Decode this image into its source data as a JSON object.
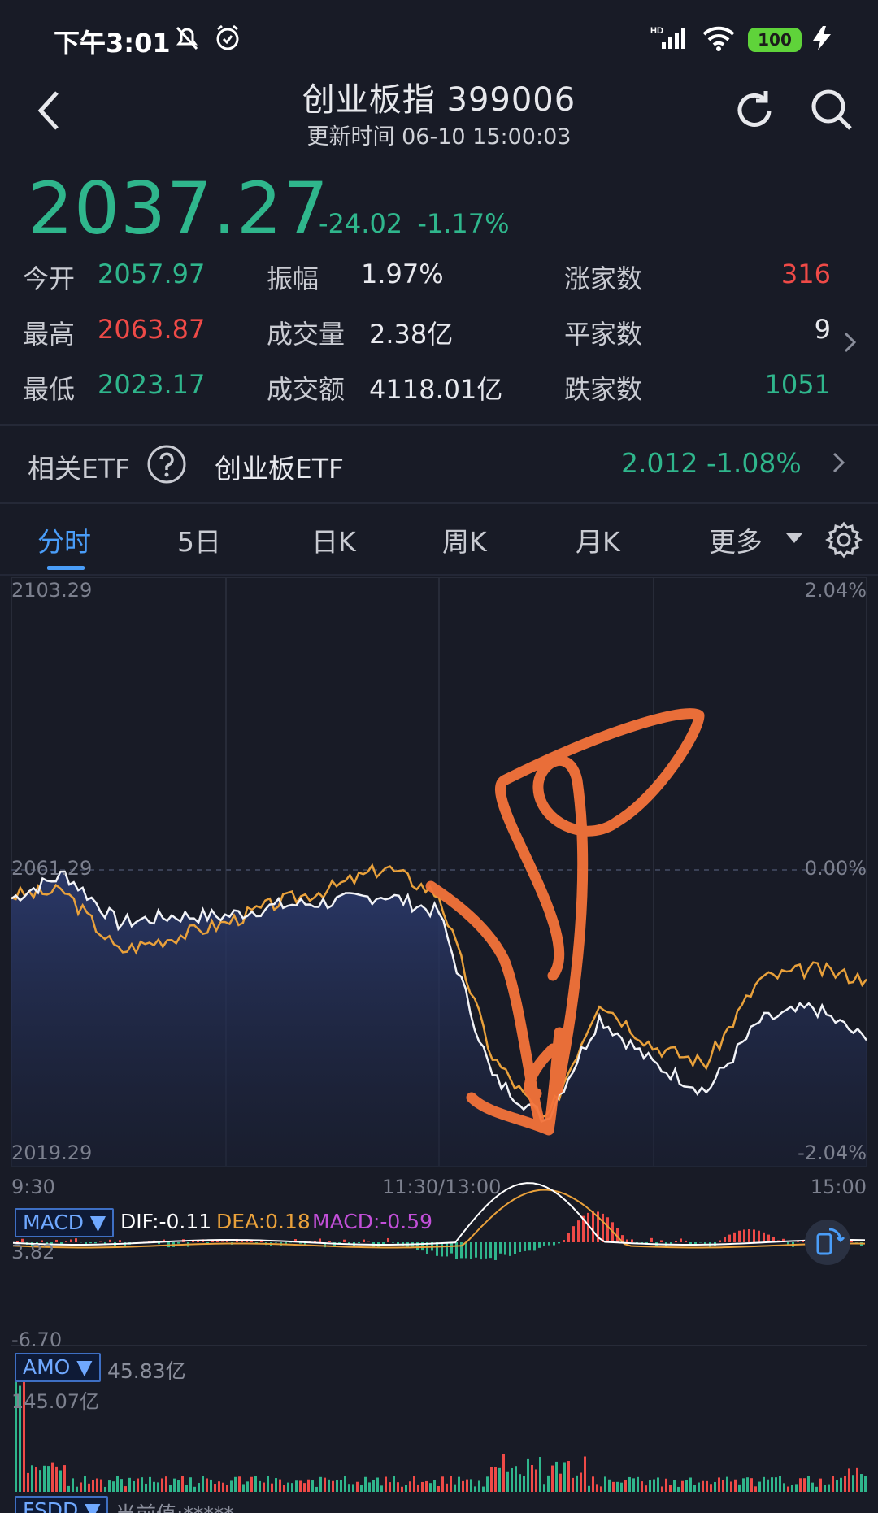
{
  "status_bar": {
    "time": "下午3:01",
    "network": "HD",
    "battery": "100"
  },
  "header": {
    "title": "创业板指 399006",
    "update_time": "更新时间 06-10 15:00:03"
  },
  "quote": {
    "price": "2037.27",
    "change": "-24.02",
    "change_pct": "-1.17%",
    "open_label": "今开",
    "open": "2057.97",
    "high_label": "最高",
    "high": "2063.87",
    "low_label": "最低",
    "low": "2023.17",
    "amplitude_label": "振幅",
    "amplitude": "1.97%",
    "volume_label": "成交量",
    "volume": "2.38亿",
    "turnover_label": "成交额",
    "turnover": "4118.01亿",
    "up_label": "涨家数",
    "up_count": "316",
    "flat_label": "平家数",
    "flat_count": "9",
    "down_label": "跌家数",
    "down_count": "1051"
  },
  "etf": {
    "label": "相关ETF",
    "name": "创业板ETF",
    "price": "2.012",
    "change_pct": "-1.08%"
  },
  "tabs": [
    "分时",
    "5日",
    "日K",
    "周K",
    "月K",
    "更多"
  ],
  "chart_labels": {
    "top_price": "2103.29",
    "mid_price": "2061.29",
    "bottom_price": "2019.29",
    "top_pct": "2.04%",
    "mid_pct": "0.00%",
    "bottom_pct": "-2.04%",
    "time_start": "9:30",
    "time_mid": "11:30/13:00",
    "time_end": "15:00"
  },
  "macd": {
    "badge": "MACD ▼",
    "dif": "DIF:-0.11",
    "dea": "DEA:0.18",
    "macd": "MACD:-0.59",
    "top": "3.82",
    "bottom": "-6.70"
  },
  "amo": {
    "badge": "AMO ▼",
    "current": "45.83亿",
    "max": "145.07亿"
  },
  "fsdd": {
    "badge": "FSDD ▼",
    "text": "当前值:*****"
  },
  "colors": {
    "up": "#ef4a47",
    "down": "#2fb68c",
    "accent": "#4a9df8",
    "avg_line": "#e9a13b",
    "annotation": "#f4733a"
  },
  "chart_data": {
    "type": "line",
    "title": "",
    "x_range": [
      "9:30",
      "15:00"
    ],
    "ylim": [
      2019.29,
      2103.29
    ],
    "pre_close": 2061.29,
    "series": [
      {
        "x": [
          "9:30",
          "9:45",
          "10:00",
          "10:15",
          "10:30",
          "10:45",
          "11:00",
          "11:15",
          "11:30",
          "13:15",
          "13:30",
          "13:45",
          "14:00",
          "14:15",
          "14:30",
          "14:45",
          "15:00"
        ],
        "values": [
          2057.5,
          2061.0,
          2054.0,
          2055.0,
          2055.0,
          2056.5,
          2057.0,
          2058.0,
          2055.5,
          2032.0,
          2026.0,
          2040.5,
          2034.0,
          2030.0,
          2040.0,
          2042.0,
          2037.3
        ]
      },
      {
        "x": [
          "9:30",
          "9:45",
          "10:00",
          "10:15",
          "10:30",
          "10:45",
          "11:00",
          "11:15",
          "11:30",
          "13:15",
          "13:30",
          "13:45",
          "14:00",
          "14:15",
          "14:30",
          "14:45",
          "15:00"
        ],
        "values": [
          2058.0,
          2058.5,
          2050.0,
          2052.0,
          2054.0,
          2057.0,
          2059.0,
          2062.0,
          2058.0,
          2035.0,
          2025.5,
          2043.0,
          2036.5,
          2034.0,
          2046.0,
          2047.5,
          2046.0
        ]
      }
    ]
  }
}
